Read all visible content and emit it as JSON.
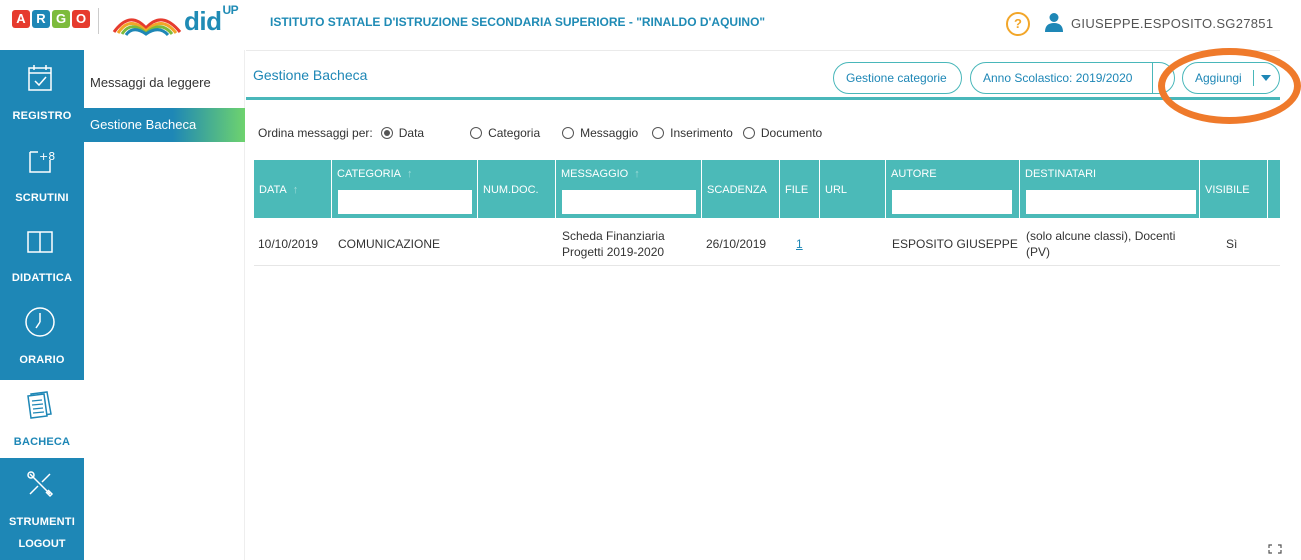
{
  "brand": {
    "argo_letters": [
      "A",
      "R",
      "G",
      "O"
    ],
    "argo_colors": [
      "#e63b2e",
      "#1e87b6",
      "#7dbb3c",
      "#e63b2e"
    ],
    "app_name": "did",
    "app_sup": "UP"
  },
  "header": {
    "school": "ISTITUTO STATALE D'ISTRUZIONE SECONDARIA SUPERIORE - \"RINALDO D'AQUINO\"",
    "help": "?",
    "username": "GIUSEPPE.ESPOSITO.SG27851"
  },
  "sidebar": {
    "items": [
      {
        "label": "REGISTRO",
        "icon": "calendar-check-icon"
      },
      {
        "label": "SCRUTINI",
        "icon": "plus-eight-icon"
      },
      {
        "label": "DIDATTICA",
        "icon": "book-icon"
      },
      {
        "label": "ORARIO",
        "icon": "clock-icon"
      },
      {
        "label": "BACHECA",
        "icon": "notice-board-icon",
        "active": true
      },
      {
        "label": "STRUMENTI",
        "icon": "tools-icon"
      }
    ],
    "logout": "LOGOUT"
  },
  "submenu": {
    "items": [
      {
        "label": "Messaggi da leggere"
      },
      {
        "label": "Gestione Bacheca",
        "active": true
      }
    ]
  },
  "main": {
    "title": "Gestione Bacheca",
    "btn_categorie": "Gestione categorie",
    "btn_anno": "Anno Scolastico: 2019/2020",
    "btn_aggiungi": "Aggiungi",
    "order_label": "Ordina messaggi per:",
    "order_options": [
      "Data",
      "Categoria",
      "Messaggio",
      "Inserimento",
      "Documento"
    ],
    "order_selected": "Data"
  },
  "table": {
    "columns": [
      "DATA",
      "CATEGORIA",
      "NUM.DOC.",
      "MESSAGGIO",
      "SCADENZA",
      "FILE",
      "URL",
      "AUTORE",
      "DESTINATARI",
      "VISIBILE"
    ],
    "sort_arrow": "↑",
    "rows": [
      {
        "data": "10/10/2019",
        "categoria": "COMUNICAZIONE",
        "num_doc": "",
        "messaggio_1": "Scheda Finanziaria",
        "messaggio_2": "Progetti 2019-2020",
        "scadenza": "26/10/2019",
        "file": "1",
        "url": "",
        "autore": "ESPOSITO GIUSEPPE",
        "destinatari_1": "(solo alcune classi), Docenti",
        "destinatari_2": "(PV)",
        "visibile": "Sì"
      }
    ]
  },
  "colors": {
    "primary": "#1e87b6",
    "teal": "#4bbab8",
    "highlight": "#ef7a2b",
    "help": "#f2a629"
  }
}
